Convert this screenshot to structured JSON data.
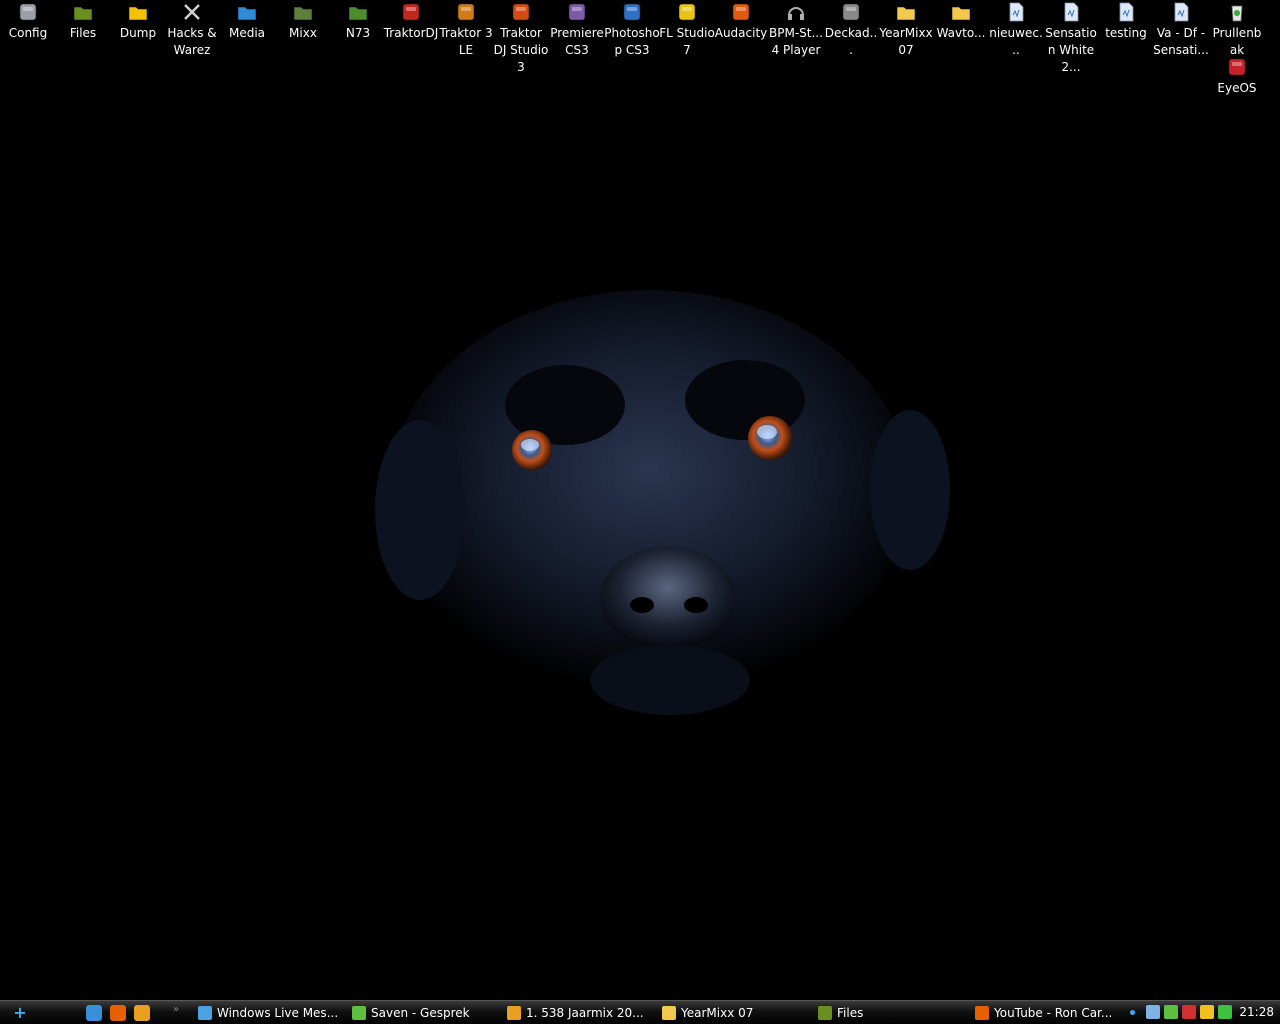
{
  "desktop": {
    "icons": [
      {
        "label": "Config",
        "icon": "config-icon",
        "color": "#9aa0a6"
      },
      {
        "label": "Files",
        "icon": "folder-download-icon",
        "color": "#6b8e23"
      },
      {
        "label": "Dump",
        "icon": "folder-star-icon",
        "color": "#f2c200"
      },
      {
        "label": "Hacks & Warez",
        "icon": "tools-icon",
        "color": "#d0d0d0"
      },
      {
        "label": "Media",
        "icon": "media-folder-icon",
        "color": "#2e8bd8"
      },
      {
        "label": "Mixx",
        "icon": "music-folder-icon",
        "color": "#5c7f3a"
      },
      {
        "label": "N73",
        "icon": "phone-folder-icon",
        "color": "#4c8c2e"
      },
      {
        "label": "TraktorDJ",
        "icon": "traktor-icon",
        "color": "#c0281e"
      },
      {
        "label": "Traktor 3 LE",
        "icon": "traktor-le-icon",
        "color": "#d07a1a"
      },
      {
        "label": "Traktor DJ Studio 3",
        "icon": "traktor-studio-icon",
        "color": "#d34a12"
      },
      {
        "label": "Premiere CS3",
        "icon": "premiere-icon",
        "color": "#7c5aa8"
      },
      {
        "label": "Photoshop CS3",
        "icon": "photoshop-icon",
        "color": "#2f6fc4"
      },
      {
        "label": "FL Studio 7",
        "icon": "fl-studio-icon",
        "color": "#e8c41a"
      },
      {
        "label": "Audacity",
        "icon": "audacity-icon",
        "color": "#e05a10"
      },
      {
        "label": "BPM-St... 4 Player",
        "icon": "headphones-icon",
        "color": "#b0b0b0"
      },
      {
        "label": "Deckad...",
        "icon": "deckadance-icon",
        "color": "#8a8a8a"
      },
      {
        "label": "YearMixx 07",
        "icon": "folder-icon",
        "color": "#f2c94c"
      },
      {
        "label": "Wavto...",
        "icon": "folder-icon",
        "color": "#f2c94c"
      },
      {
        "label": "nieuwec...",
        "icon": "audio-file-icon",
        "color": "#dfe8f5"
      },
      {
        "label": "Sensation White 2...",
        "icon": "audio-file-icon",
        "color": "#dfe8f5"
      },
      {
        "label": "testing",
        "icon": "audio-file-icon",
        "color": "#dfe8f5"
      },
      {
        "label": "Va - Df - Sensati...",
        "icon": "audio-file-icon",
        "color": "#dfe8f5"
      },
      {
        "label": "Prullenbak",
        "icon": "recycle-bin-icon",
        "color": "#e6e6e6"
      },
      {
        "label": "EyeOS",
        "icon": "eyeos-icon",
        "color": "#c8202a"
      }
    ]
  },
  "taskbar": {
    "start_glyph": "+",
    "quick_launch": [
      {
        "icon": "ie-icon",
        "color": "#3a8fd6"
      },
      {
        "icon": "firefox-icon",
        "color": "#e66000"
      },
      {
        "icon": "winamp-icon",
        "color": "#e8a020"
      }
    ],
    "overflow_glyph": "»",
    "tasks": [
      {
        "label": "Windows Live Mes...",
        "icon": "messenger-icon",
        "color": "#4aa3df"
      },
      {
        "label": "Saven - Gesprek",
        "icon": "messenger-chat-icon",
        "color": "#5fbf3f"
      },
      {
        "label": "1. 538 Jaarmix 20...",
        "icon": "winamp-icon",
        "color": "#e8a020"
      },
      {
        "label": "YearMixx 07",
        "icon": "folder-icon",
        "color": "#f2c94c"
      },
      {
        "label": "Files",
        "icon": "folder-download-icon",
        "color": "#6b8e23"
      },
      {
        "label": "YouTube - Ron Car...",
        "icon": "firefox-icon",
        "color": "#e66000"
      }
    ],
    "tray": [
      {
        "icon": "tray-dot-icon",
        "color": "#3fa9f5"
      },
      {
        "icon": "network-icon",
        "color": "#7fb3e6"
      },
      {
        "icon": "messenger-tray-icon",
        "color": "#5fbf3f"
      },
      {
        "icon": "security-alert-icon",
        "color": "#d03030"
      },
      {
        "icon": "tray-app-icon",
        "color": "#f0c020"
      },
      {
        "icon": "volume-meter-icon",
        "color": "#40c040"
      }
    ],
    "clock": "21:28"
  }
}
